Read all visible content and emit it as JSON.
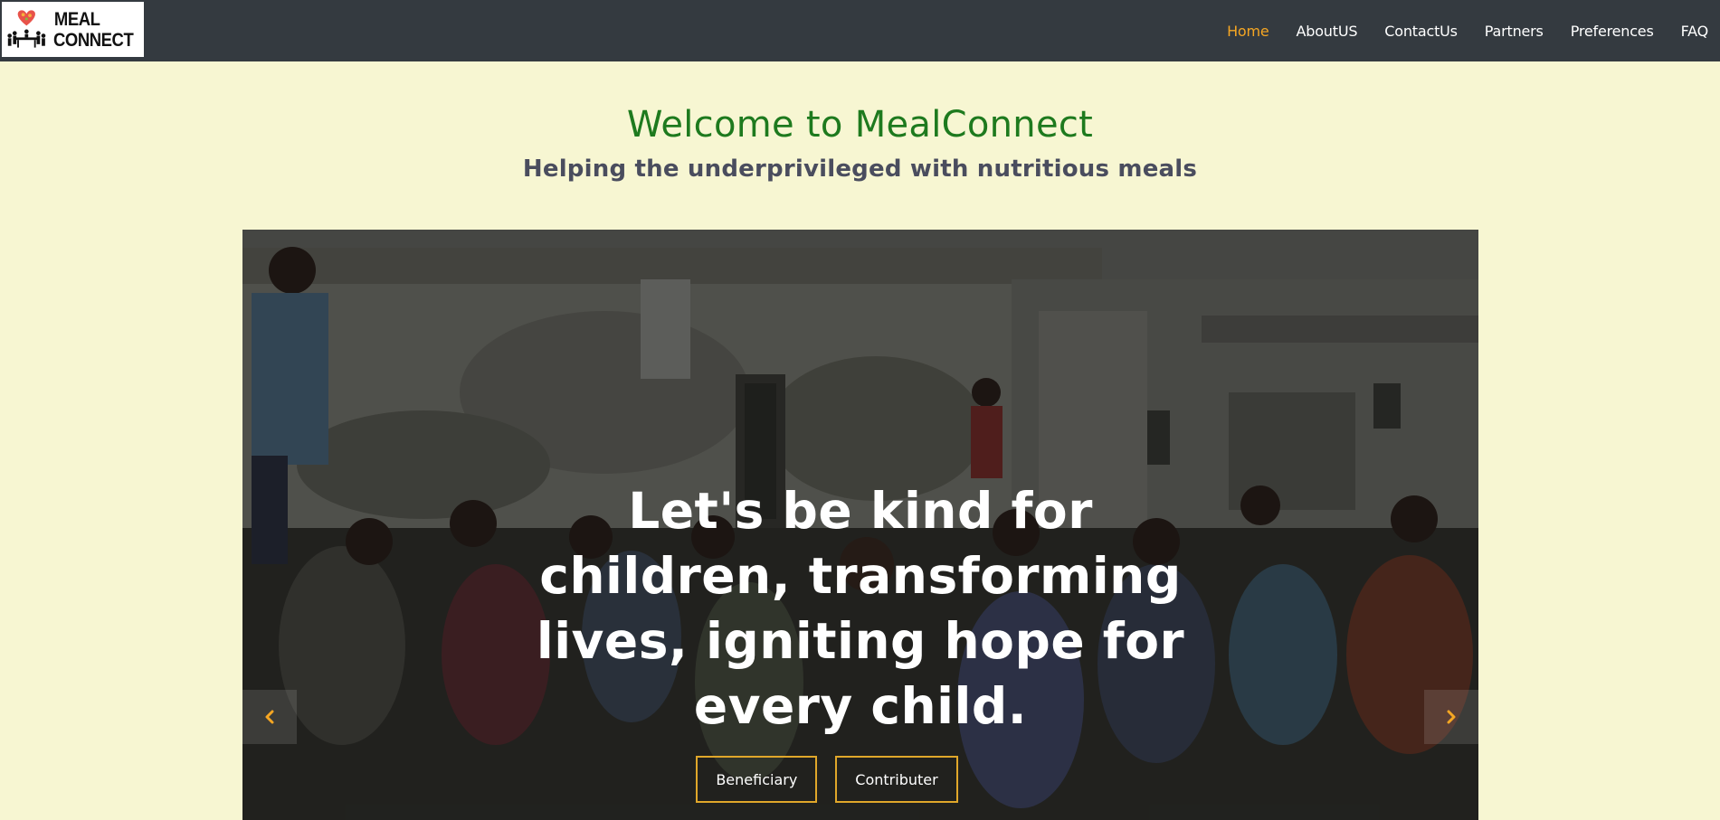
{
  "brand": {
    "logo_line1": "MEAL",
    "logo_line2": "CONNECT"
  },
  "nav": {
    "items": [
      {
        "label": "Home",
        "active": true
      },
      {
        "label": "AboutUS",
        "active": false
      },
      {
        "label": "ContactUs",
        "active": false
      },
      {
        "label": "Partners",
        "active": false
      },
      {
        "label": "Preferences",
        "active": false
      },
      {
        "label": "FAQ",
        "active": false
      }
    ]
  },
  "hero": {
    "title": "Welcome to MealConnect",
    "subtitle": "Helping the underprivileged with nutritious meals"
  },
  "carousel": {
    "caption_lines": [
      "Let's be kind for",
      "children, transforming",
      "lives, igniting hope for",
      "every child."
    ],
    "buttons": {
      "beneficiary": "Beneficiary",
      "contributer": "Contributer"
    },
    "prev_icon": "chevron-left-icon",
    "next_icon": "chevron-right-icon"
  },
  "colors": {
    "navbar_bg": "#343a40",
    "page_bg": "#f7f6d2",
    "accent": "#f5a623",
    "heading_green": "#1e7a1e",
    "subtitle_gray": "#4a4d5e",
    "button_border": "#e0a72a"
  }
}
